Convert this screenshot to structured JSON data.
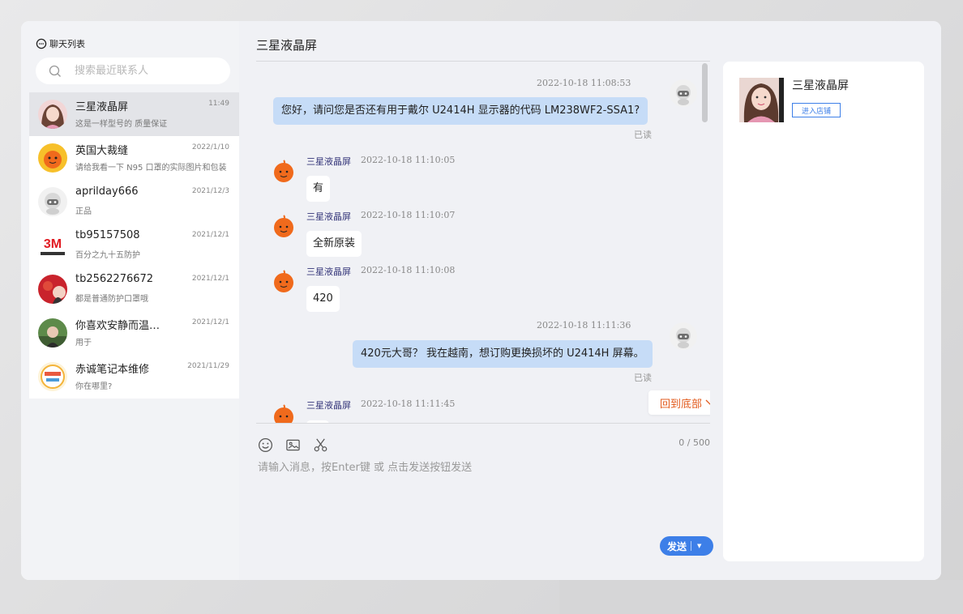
{
  "sidebar": {
    "title": "聊天列表",
    "search_placeholder": "搜索最近联系人",
    "contacts": [
      {
        "name": "三星液晶屏",
        "time": "11:49",
        "preview": "这是一样型号的 质量保证",
        "avatar": "pink-hair-woman-photo",
        "active": true
      },
      {
        "name": "英国大裁缝",
        "time": "2022/1/10",
        "preview": "请给我看一下 N95 口罩的实际图片和包装",
        "avatar": "taobao-mascot-orange"
      },
      {
        "name": "aprilday666",
        "time": "2021/12/3",
        "preview": "正品",
        "avatar": "robot-mascot-grey"
      },
      {
        "name": "tb95157508",
        "time": "2021/12/1",
        "preview": "百分之九十五防护",
        "avatar": "3m-logo"
      },
      {
        "name": "tb2562276672",
        "time": "2021/12/1",
        "preview": "都是普通防护口罩哦",
        "avatar": "red-lantern-photo"
      },
      {
        "name": "你喜欢安静而温暖的",
        "time": "2021/12/1",
        "preview": "用于",
        "avatar": "outdoor-portrait-photo"
      },
      {
        "name": "赤诚笔记本维修",
        "time": "2021/11/29",
        "preview": "你在哪里?",
        "avatar": "shop-badge-logo"
      }
    ]
  },
  "chat": {
    "title": "三星液晶屏",
    "read_label": "已读",
    "msg1": {
      "time": "2022-10-18 11:08:53",
      "text": "您好，请问您是否还有用于戴尔 U2414H 显示器的代码 LM238WF2-SSA1?"
    },
    "msg2": {
      "sender": "三星液晶屏",
      "time": "2022-10-18 11:10:05",
      "text": "有"
    },
    "msg3": {
      "sender": "三星液晶屏",
      "time": "2022-10-18 11:10:07",
      "text": "全新原装"
    },
    "msg4": {
      "sender": "三星液晶屏",
      "time": "2022-10-18 11:10:08",
      "text": "420"
    },
    "msg5": {
      "time": "2022-10-18 11:11:36",
      "text": "420元大哥？ 我在越南，想订购更换损坏的 U2414H 屏幕。"
    },
    "msg6": {
      "sender": "三星液晶屏",
      "time": "2022-10-18 11:11:45"
    },
    "jump_label": "回到底部",
    "counter": "0 / 500",
    "input_placeholder": "请输入消息，按Enter键 或 点击发送按钮发送",
    "send_label": "发送"
  },
  "shop": {
    "name": "三星液晶屏",
    "enter_label": "进入店铺"
  },
  "colors": {
    "accent": "#3d7fe8",
    "bubble_out": "#c6dcf7",
    "jump_text": "#e25a1c",
    "sender_name": "#35367a"
  }
}
